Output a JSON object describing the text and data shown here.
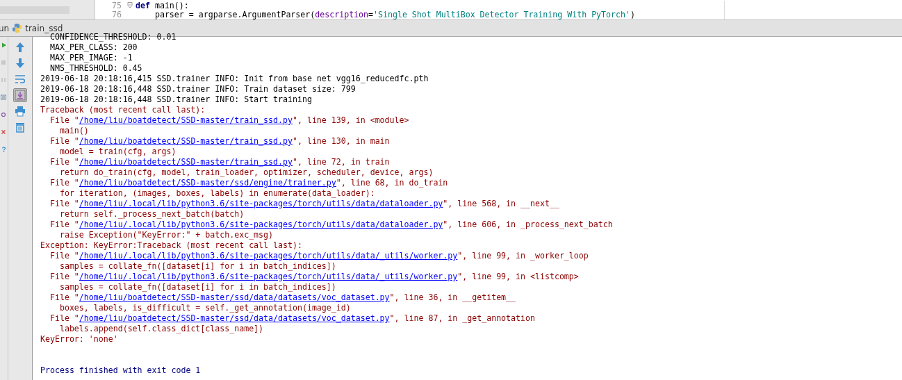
{
  "editor": {
    "lines": [
      {
        "number": "75",
        "folded": true,
        "segments": [
          {
            "kind": "keyword",
            "text": "def "
          },
          {
            "kind": "plain",
            "text": "main():"
          }
        ]
      },
      {
        "number": "76",
        "folded": false,
        "segments": [
          {
            "kind": "plain",
            "text": "    parser = argparse.ArgumentParser("
          },
          {
            "kind": "param",
            "text": "description"
          },
          {
            "kind": "plain",
            "text": "="
          },
          {
            "kind": "string",
            "text": "'Single Shot MultiBox Detector Training With PyTorch'"
          },
          {
            "kind": "plain",
            "text": ")"
          }
        ]
      }
    ]
  },
  "run_bar": {
    "label": "un",
    "config": "train_ssd"
  },
  "toolbar_outer": [
    {
      "kind": "run",
      "disabled": false
    },
    {
      "kind": "stop",
      "disabled": true
    },
    {
      "kind": "pause",
      "disabled": true
    },
    {
      "kind": "layout",
      "disabled": false
    },
    {
      "kind": "debug",
      "disabled": false
    },
    {
      "kind": "close",
      "disabled": false
    },
    {
      "kind": "help",
      "disabled": false
    }
  ],
  "toolbar_inner": [
    {
      "kind": "up",
      "selected": false
    },
    {
      "kind": "down",
      "selected": false
    },
    {
      "kind": "wrap",
      "selected": false
    },
    {
      "kind": "scroll-end",
      "selected": true
    },
    {
      "kind": "print",
      "selected": false
    },
    {
      "kind": "trash",
      "selected": false
    }
  ],
  "console": [
    {
      "segments": [
        {
          "kind": "plain",
          "text": "  CONFIDENCE_THRESHOLD: 0.01"
        }
      ]
    },
    {
      "segments": [
        {
          "kind": "plain",
          "text": "  MAX_PER_CLASS: 200"
        }
      ]
    },
    {
      "segments": [
        {
          "kind": "plain",
          "text": "  MAX_PER_IMAGE: -1"
        }
      ]
    },
    {
      "segments": [
        {
          "kind": "plain",
          "text": "  NMS_THRESHOLD: 0.45"
        }
      ]
    },
    {
      "segments": [
        {
          "kind": "plain",
          "text": "2019-06-18 20:18:16,415 SSD.trainer INFO: Init from base net vgg16_reducedfc.pth"
        }
      ]
    },
    {
      "segments": [
        {
          "kind": "plain",
          "text": "2019-06-18 20:18:16,448 SSD.trainer INFO: Train dataset size: 799"
        }
      ]
    },
    {
      "segments": [
        {
          "kind": "plain",
          "text": "2019-06-18 20:18:16,448 SSD.trainer INFO: Start training"
        }
      ]
    },
    {
      "segments": [
        {
          "kind": "error",
          "text": "Traceback (most recent call last):"
        }
      ]
    },
    {
      "segments": [
        {
          "kind": "error",
          "text": "  File \""
        },
        {
          "kind": "link",
          "text": "/home/liu/boatdetect/SSD-master/train_ssd.py"
        },
        {
          "kind": "error",
          "text": "\", line 139, in <module>"
        }
      ]
    },
    {
      "segments": [
        {
          "kind": "error",
          "text": "    main()"
        }
      ]
    },
    {
      "segments": [
        {
          "kind": "error",
          "text": "  File \""
        },
        {
          "kind": "link",
          "text": "/home/liu/boatdetect/SSD-master/train_ssd.py"
        },
        {
          "kind": "error",
          "text": "\", line 130, in main"
        }
      ]
    },
    {
      "segments": [
        {
          "kind": "error",
          "text": "    model = train(cfg, args)"
        }
      ]
    },
    {
      "segments": [
        {
          "kind": "error",
          "text": "  File \""
        },
        {
          "kind": "link",
          "text": "/home/liu/boatdetect/SSD-master/train_ssd.py"
        },
        {
          "kind": "error",
          "text": "\", line 72, in train"
        }
      ]
    },
    {
      "segments": [
        {
          "kind": "error",
          "text": "    return do_train(cfg, model, train_loader, optimizer, scheduler, device, args)"
        }
      ]
    },
    {
      "segments": [
        {
          "kind": "error",
          "text": "  File \""
        },
        {
          "kind": "link",
          "text": "/home/liu/boatdetect/SSD-master/ssd/engine/trainer.py"
        },
        {
          "kind": "error",
          "text": "\", line 68, in do_train"
        }
      ]
    },
    {
      "segments": [
        {
          "kind": "error",
          "text": "    for iteration, (images, boxes, labels) in enumerate(data_loader):"
        }
      ]
    },
    {
      "segments": [
        {
          "kind": "error",
          "text": "  File \""
        },
        {
          "kind": "link",
          "text": "/home/liu/.local/lib/python3.6/site-packages/torch/utils/data/dataloader.py"
        },
        {
          "kind": "error",
          "text": "\", line 568, in __next__"
        }
      ]
    },
    {
      "segments": [
        {
          "kind": "error",
          "text": "    return self._process_next_batch(batch)"
        }
      ]
    },
    {
      "segments": [
        {
          "kind": "error",
          "text": "  File \""
        },
        {
          "kind": "link",
          "text": "/home/liu/.local/lib/python3.6/site-packages/torch/utils/data/dataloader.py"
        },
        {
          "kind": "error",
          "text": "\", line 606, in _process_next_batch"
        }
      ]
    },
    {
      "segments": [
        {
          "kind": "error",
          "text": "    raise Exception(\"KeyError:\" + batch.exc_msg)"
        }
      ]
    },
    {
      "segments": [
        {
          "kind": "error",
          "text": "Exception: KeyError:Traceback (most recent call last):"
        }
      ]
    },
    {
      "segments": [
        {
          "kind": "error",
          "text": "  File \""
        },
        {
          "kind": "link",
          "text": "/home/liu/.local/lib/python3.6/site-packages/torch/utils/data/_utils/worker.py"
        },
        {
          "kind": "error",
          "text": "\", line 99, in _worker_loop"
        }
      ]
    },
    {
      "segments": [
        {
          "kind": "error",
          "text": "    samples = collate_fn([dataset[i] for i in batch_indices])"
        }
      ]
    },
    {
      "segments": [
        {
          "kind": "error",
          "text": "  File \""
        },
        {
          "kind": "link",
          "text": "/home/liu/.local/lib/python3.6/site-packages/torch/utils/data/_utils/worker.py"
        },
        {
          "kind": "error",
          "text": "\", line 99, in <listcomp>"
        }
      ]
    },
    {
      "segments": [
        {
          "kind": "error",
          "text": "    samples = collate_fn([dataset[i] for i in batch_indices])"
        }
      ]
    },
    {
      "segments": [
        {
          "kind": "error",
          "text": "  File \""
        },
        {
          "kind": "link",
          "text": "/home/liu/boatdetect/SSD-master/ssd/data/datasets/voc_dataset.py"
        },
        {
          "kind": "error",
          "text": "\", line 36, in __getitem__"
        }
      ]
    },
    {
      "segments": [
        {
          "kind": "error",
          "text": "    boxes, labels, is_difficult = self._get_annotation(image_id)"
        }
      ]
    },
    {
      "segments": [
        {
          "kind": "error",
          "text": "  File \""
        },
        {
          "kind": "link",
          "text": "/home/liu/boatdetect/SSD-master/ssd/data/datasets/voc_dataset.py"
        },
        {
          "kind": "error",
          "text": "\", line 87, in _get_annotation"
        }
      ]
    },
    {
      "segments": [
        {
          "kind": "error",
          "text": "    labels.append(self.class_dict[class_name])"
        }
      ]
    },
    {
      "segments": [
        {
          "kind": "error",
          "text": "KeyError: 'none'"
        }
      ]
    },
    {
      "kind": "blank"
    },
    {
      "kind": "blank"
    },
    {
      "segments": [
        {
          "kind": "system",
          "text": "Process finished with exit code 1"
        }
      ]
    }
  ]
}
